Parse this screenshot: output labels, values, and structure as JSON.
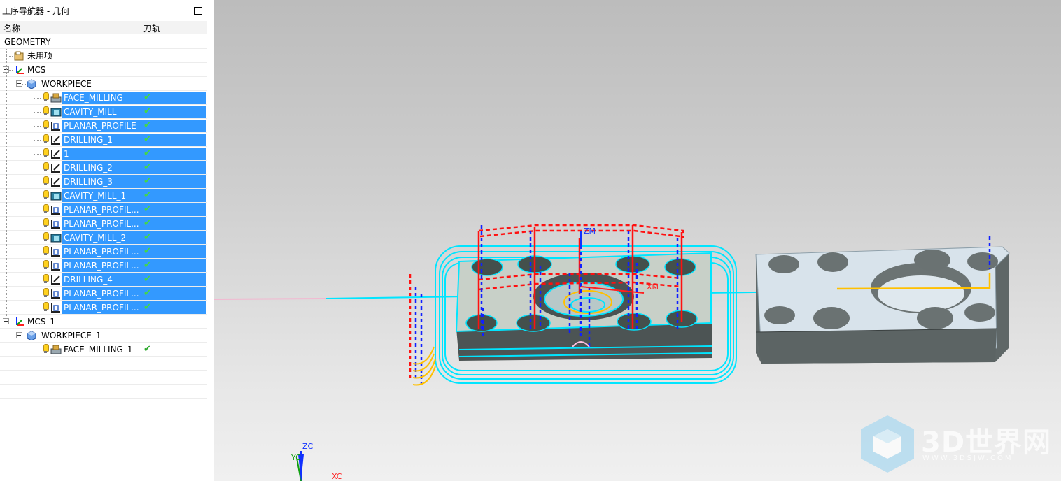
{
  "navigator": {
    "title": "工序导航器 - 几何",
    "columns": {
      "name": "名称",
      "toolpath": "刀轨"
    },
    "rows": [
      {
        "label": "GEOMETRY",
        "level": 0,
        "type": "root",
        "selected": false,
        "check": ""
      },
      {
        "label": "未用项",
        "level": 1,
        "type": "unused",
        "selected": false,
        "check": ""
      },
      {
        "label": "MCS",
        "level": 1,
        "type": "mcs",
        "selected": false,
        "check": ""
      },
      {
        "label": "WORKPIECE",
        "level": 2,
        "type": "workpiece",
        "selected": false,
        "check": ""
      },
      {
        "label": "FACE_MILLING",
        "level": 3,
        "type": "face",
        "selected": true,
        "check": "✔"
      },
      {
        "label": "CAVITY_MILL",
        "level": 3,
        "type": "cavity",
        "selected": true,
        "check": "✔"
      },
      {
        "label": "PLANAR_PROFILE",
        "level": 3,
        "type": "planar",
        "selected": true,
        "check": "✔"
      },
      {
        "label": "DRILLING_1",
        "level": 3,
        "type": "drill",
        "selected": true,
        "check": "✔"
      },
      {
        "label": "1",
        "level": 3,
        "type": "drill",
        "selected": true,
        "check": "✔"
      },
      {
        "label": "DRILLING_2",
        "level": 3,
        "type": "drill",
        "selected": true,
        "check": "✔"
      },
      {
        "label": "DRILLING_3",
        "level": 3,
        "type": "drill",
        "selected": true,
        "check": "✔"
      },
      {
        "label": "CAVITY_MILL_1",
        "level": 3,
        "type": "cavity",
        "selected": true,
        "check": "✔"
      },
      {
        "label": "PLANAR_PROFIL...",
        "level": 3,
        "type": "planar",
        "selected": true,
        "check": "✔"
      },
      {
        "label": "PLANAR_PROFIL...",
        "level": 3,
        "type": "planar",
        "selected": true,
        "check": "✔"
      },
      {
        "label": "CAVITY_MILL_2",
        "level": 3,
        "type": "cavity",
        "selected": true,
        "check": "✔"
      },
      {
        "label": "PLANAR_PROFIL...",
        "level": 3,
        "type": "planar",
        "selected": true,
        "check": "✔"
      },
      {
        "label": "PLANAR_PROFIL...",
        "level": 3,
        "type": "planar",
        "selected": true,
        "check": "✔"
      },
      {
        "label": "DRILLING_4",
        "level": 3,
        "type": "drill",
        "selected": true,
        "check": "✔"
      },
      {
        "label": "PLANAR_PROFIL...",
        "level": 3,
        "type": "planar",
        "selected": true,
        "check": "✔"
      },
      {
        "label": "PLANAR_PROFIL...",
        "level": 3,
        "type": "planar",
        "selected": true,
        "check": "✔"
      },
      {
        "label": "MCS_1",
        "level": 1,
        "type": "mcs",
        "selected": false,
        "check": ""
      },
      {
        "label": "WORKPIECE_1",
        "level": 2,
        "type": "workpiece",
        "selected": false,
        "check": ""
      },
      {
        "label": "FACE_MILLING_1",
        "level": 3,
        "type": "face",
        "selected": false,
        "check": "✔"
      },
      {
        "label": "",
        "level": 0,
        "type": "empty",
        "selected": false,
        "check": ""
      },
      {
        "label": "",
        "level": 0,
        "type": "empty",
        "selected": false,
        "check": ""
      },
      {
        "label": "",
        "level": 0,
        "type": "empty",
        "selected": false,
        "check": ""
      },
      {
        "label": "",
        "level": 0,
        "type": "empty",
        "selected": false,
        "check": ""
      },
      {
        "label": "",
        "level": 0,
        "type": "empty",
        "selected": false,
        "check": ""
      },
      {
        "label": "",
        "level": 0,
        "type": "empty",
        "selected": false,
        "check": ""
      },
      {
        "label": "",
        "level": 0,
        "type": "empty",
        "selected": false,
        "check": ""
      },
      {
        "label": "",
        "level": 0,
        "type": "empty",
        "selected": false,
        "check": ""
      }
    ]
  },
  "viewport": {
    "labels": {
      "zm": "ZM",
      "xm": "XM",
      "zc": "ZC",
      "yc": "YC",
      "xc": "XC"
    },
    "watermark": {
      "text": "3D世界网",
      "url": "WWW.3DSJW.COM"
    },
    "colors": {
      "selection": "#3399ff",
      "toolpath_cyan": "#00e5ff",
      "toolpath_red": "#ff1010",
      "toolpath_blue": "#1020ff",
      "toolpath_yellow": "#ffc000",
      "part_face": "#d8e4ec",
      "part_side": "#606868"
    }
  }
}
